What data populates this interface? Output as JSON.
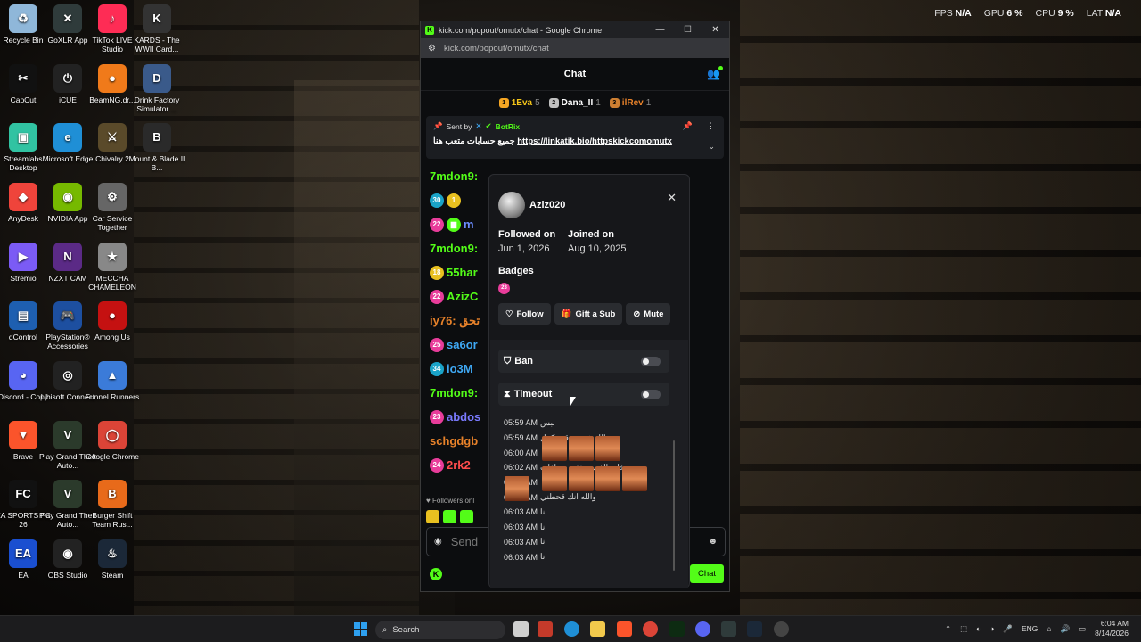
{
  "hud": {
    "fps_label": "FPS",
    "fps": "N/A",
    "gpu_label": "GPU",
    "gpu": "6 %",
    "cpu_label": "CPU",
    "cpu": "9 %",
    "lat_label": "LAT",
    "lat": "N/A"
  },
  "desktop_icons": [
    {
      "label": "Recycle Bin",
      "glyph": "♻",
      "color": "#8fb7d9"
    },
    {
      "label": "GoXLR App",
      "glyph": "✕",
      "color": "#2f3b3b"
    },
    {
      "label": "TikTok LIVE Studio",
      "glyph": "♪",
      "color": "#fe2c55"
    },
    {
      "label": "KARDS - The WWII Card...",
      "glyph": "K",
      "color": "#333"
    },
    {
      "label": "CapCut",
      "glyph": "✂",
      "color": "#111"
    },
    {
      "label": "iCUE",
      "glyph": "⏻",
      "color": "#222"
    },
    {
      "label": "BeamNG.dr...",
      "glyph": "●",
      "color": "#f07a1a"
    },
    {
      "label": "Drink Factory Simulator ...",
      "glyph": "D",
      "color": "#3a5a8a"
    },
    {
      "label": "Streamlabs Desktop",
      "glyph": "▣",
      "color": "#31c3a2"
    },
    {
      "label": "Microsoft Edge",
      "glyph": "e",
      "color": "#1f8fd6"
    },
    {
      "label": "Chivalry 2",
      "glyph": "⚔",
      "color": "#5a4a2a"
    },
    {
      "label": "Mount & Blade II B...",
      "glyph": "B",
      "color": "#2a2a2a"
    },
    {
      "label": "AnyDesk",
      "glyph": "◆",
      "color": "#ef443b"
    },
    {
      "label": "NVIDIA App",
      "glyph": "◉",
      "color": "#76b900"
    },
    {
      "label": "Car Service Together",
      "glyph": "⚙",
      "color": "#666"
    },
    {
      "label": "Stremio",
      "glyph": "▶",
      "color": "#7b5bf5"
    },
    {
      "label": "NZXT CAM",
      "glyph": "N",
      "color": "#5b2a86"
    },
    {
      "label": "MECCHA CHAMELEON",
      "glyph": "★",
      "color": "#888"
    },
    {
      "label": "dControl",
      "glyph": "▤",
      "color": "#1e5fb0"
    },
    {
      "label": "PlayStation® Accessories",
      "glyph": "🎮",
      "color": "#1d4fa0"
    },
    {
      "label": "Among Us",
      "glyph": "●",
      "color": "#c51111"
    },
    {
      "label": "Discord - Copy",
      "glyph": "◕",
      "color": "#5865f2"
    },
    {
      "label": "Ubisoft Connect",
      "glyph": "◎",
      "color": "#222"
    },
    {
      "label": "Funnel Runners",
      "glyph": "▲",
      "color": "#3b7bd9"
    },
    {
      "label": "Brave",
      "glyph": "▼",
      "color": "#fb542b"
    },
    {
      "label": "Play Grand Theft Auto...",
      "glyph": "V",
      "color": "#2b3a2b"
    },
    {
      "label": "Google Chrome",
      "glyph": "◯",
      "color": "#db4437"
    },
    {
      "label": "EA SPORTS FC 26",
      "glyph": "FC",
      "color": "#111"
    },
    {
      "label": "Play Grand Theft Auto...",
      "glyph": "V",
      "color": "#2b3a2b"
    },
    {
      "label": "Burger Shift Team Rus...",
      "glyph": "B",
      "color": "#e86a1a"
    },
    {
      "label": "EA",
      "glyph": "EA",
      "color": "#1a4fd0"
    },
    {
      "label": "OBS Studio",
      "glyph": "◉",
      "color": "#222"
    },
    {
      "label": "Steam",
      "glyph": "♨",
      "color": "#1b2838"
    }
  ],
  "browser": {
    "title": "kick.com/popout/omutx/chat - Google Chrome",
    "url": "kick.com/popout/omutx/chat",
    "minimize": "—",
    "maximize": "☐",
    "close": "✕"
  },
  "chat": {
    "header": "Chat",
    "leaderboard": [
      {
        "rank": "1",
        "name": "1Eva",
        "count": "5",
        "color": "#f5a623",
        "name_color": "#f5c518"
      },
      {
        "rank": "2",
        "name": "Dana_II",
        "count": "1",
        "color": "#c0c0c0",
        "name_color": "#ffffff"
      },
      {
        "rank": "3",
        "name": "ilRev",
        "count": "1",
        "color": "#cd7f32",
        "name_color": "#e8822a"
      }
    ],
    "pinned": {
      "sent_by": "Sent by",
      "author": "BotRix",
      "text": "جميع حسابات متعب هنا",
      "link": "https://linkatik.bio/httpskickcomomutx"
    },
    "messages": [
      {
        "badges": [],
        "user": "7mdon9:",
        "color": "#53fc18"
      },
      {
        "badges": [
          {
            "t": "30",
            "c": "#1aa3c8"
          },
          {
            "t": "1",
            "c": "#e8c020"
          }
        ],
        "user": "",
        "color": "#ffffff"
      },
      {
        "badges": [
          {
            "t": "22",
            "c": "#e83c9a"
          },
          {
            "t": "▆",
            "c": "#53fc18"
          }
        ],
        "user": "m",
        "color": "#6b8cff"
      },
      {
        "badges": [],
        "user": "7mdon9:",
        "color": "#53fc18"
      },
      {
        "badges": [
          {
            "t": "18",
            "c": "#e8c020"
          }
        ],
        "user": "55har",
        "color": "#53fc18"
      },
      {
        "badges": [
          {
            "t": "22",
            "c": "#e83c9a"
          }
        ],
        "user": "AzizC",
        "color": "#53fc18"
      },
      {
        "badges": [],
        "user": "iy76: تحق",
        "color": "#e8822a"
      },
      {
        "badges": [
          {
            "t": "25",
            "c": "#e83c9a"
          }
        ],
        "user": "sa6or",
        "color": "#3fa9f5"
      },
      {
        "badges": [
          {
            "t": "34",
            "c": "#1aa3c8"
          }
        ],
        "user": "io3M",
        "color": "#3fa9f5"
      },
      {
        "badges": [],
        "user": "7mdon9:",
        "color": "#53fc18"
      },
      {
        "badges": [
          {
            "t": "23",
            "c": "#e83c9a"
          }
        ],
        "user": "abdos",
        "color": "#7a7aff"
      },
      {
        "badges": [],
        "user": "schgdgb",
        "color": "#e8822a"
      },
      {
        "badges": [
          {
            "t": "24",
            "c": "#e83c9a"
          }
        ],
        "user": "2rk2",
        "color": "#ff4d4d"
      }
    ],
    "followers_note": "Followers onl",
    "send_placeholder": "Send",
    "chat_button": "Chat"
  },
  "user_card": {
    "username": "Aziz020",
    "followed_label": "Followed on",
    "followed_date": "Jun 1, 2026",
    "joined_label": "Joined on",
    "joined_date": "Aug 10, 2025",
    "badges_label": "Badges",
    "badge_value": "23",
    "follow": "Follow",
    "gift": "Gift a Sub",
    "mute": "Mute",
    "ban": "Ban",
    "timeout": "Timeout",
    "log": [
      {
        "time": "05:59 AM",
        "text": "نبس"
      },
      {
        "time": "05:59 AM",
        "text": "والله ذي صدقت كمل"
      },
      {
        "time": "06:00 AM",
        "text": ""
      },
      {
        "time": "06:02 AM",
        "text": "خلي الفيس هذي صرافات"
      },
      {
        "time": "06:03 AM",
        "text": ""
      },
      {
        "time": "06:03 AM",
        "text": "والله انك قحطني"
      },
      {
        "time": "06:03 AM",
        "text": "انا"
      },
      {
        "time": "06:03 AM",
        "text": "انا"
      },
      {
        "time": "06:03 AM",
        "text": "انا"
      },
      {
        "time": "06:03 AM",
        "text": "انا"
      }
    ]
  },
  "taskbar": {
    "search": "Search",
    "lang": "ENG",
    "time": "6:04 AM",
    "date": "8/14/2026"
  }
}
